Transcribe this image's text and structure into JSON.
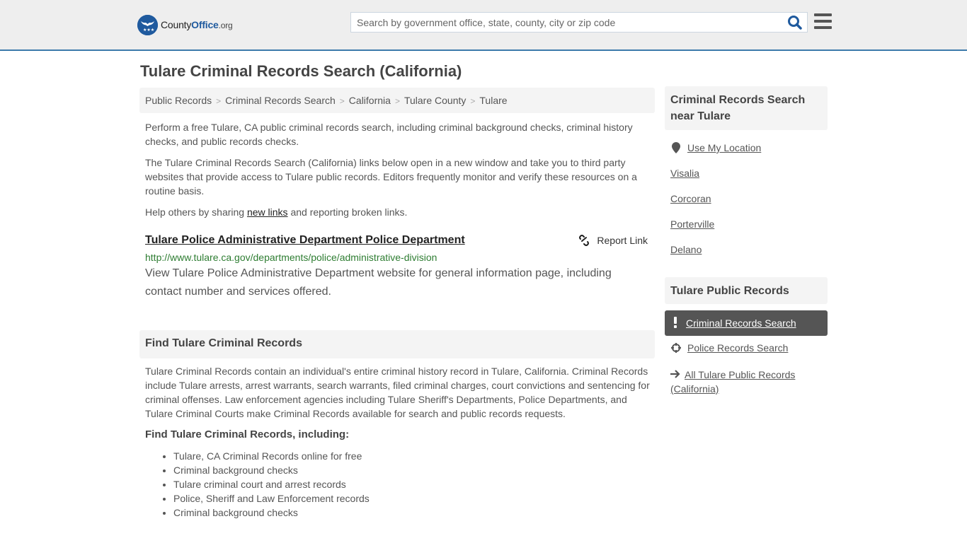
{
  "header": {
    "logo": {
      "name_part1": "County",
      "name_part2": "Office",
      "name_suffix": ".org",
      "brand_color": "#1f5a9e"
    },
    "search": {
      "placeholder": "Search by government office, state, county, city or zip code",
      "value": ""
    },
    "search_icon": "search-icon",
    "menu_icon": "hamburger-menu-icon",
    "accent_border_color": "#3d7aab"
  },
  "page": {
    "title": "Tulare Criminal Records Search (California)"
  },
  "breadcrumb": [
    {
      "label": "Public Records"
    },
    {
      "label": "Criminal Records Search"
    },
    {
      "label": "California"
    },
    {
      "label": "Tulare County"
    },
    {
      "label": "Tulare"
    }
  ],
  "breadcrumb_separator": ">",
  "intro": {
    "p1": "Perform a free Tulare, CA public criminal records search, including criminal background checks, criminal history checks, and public records checks.",
    "p2": "The Tulare Criminal Records Search (California) links below open in a new window and take you to third party websites that provide access to Tulare public records. Editors frequently monitor and verify these resources on a routine basis.",
    "p3_before": "Help others by sharing ",
    "p3_link": "new links",
    "p3_after": " and reporting broken links."
  },
  "resources": [
    {
      "title": "Tulare Police Administrative Department Police Department",
      "url": "http://www.tulare.ca.gov/departments/police/administrative-division",
      "description": "View Tulare Police Administrative Department website for general information page, including contact number and services offered.",
      "report_label": "Report Link"
    }
  ],
  "find_section": {
    "heading": "Find Tulare Criminal Records",
    "body": "Tulare Criminal Records contain an individual's entire criminal history record in Tulare, California. Criminal Records include Tulare arrests, arrest warrants, search warrants, filed criminal charges, court convictions and sentencing for criminal offenses. Law enforcement agencies including Tulare Sheriff's Departments, Police Departments, and Tulare Criminal Courts make Criminal Records available for search and public records requests.",
    "sub_heading": "Find Tulare Criminal Records, including:",
    "bullets": [
      "Tulare, CA Criminal Records online for free",
      "Criminal background checks",
      "Tulare criminal court and arrest records",
      "Police, Sheriff and Law Enforcement records",
      "Criminal background checks"
    ]
  },
  "sidebar": {
    "nearby_heading": "Criminal Records Search near Tulare",
    "use_location": "Use My Location",
    "nearby": [
      "Visalia",
      "Corcoran",
      "Porterville",
      "Delano"
    ],
    "public_records_heading": "Tulare Public Records",
    "public_records_links": [
      {
        "label": "Criminal Records Search",
        "icon": "exclamation-icon",
        "active": true
      },
      {
        "label": "Police Records Search",
        "icon": "crosshair-icon",
        "active": false
      },
      {
        "label": "All Tulare Public Records (California)",
        "icon": "arrow-right-icon",
        "active": false
      }
    ]
  }
}
